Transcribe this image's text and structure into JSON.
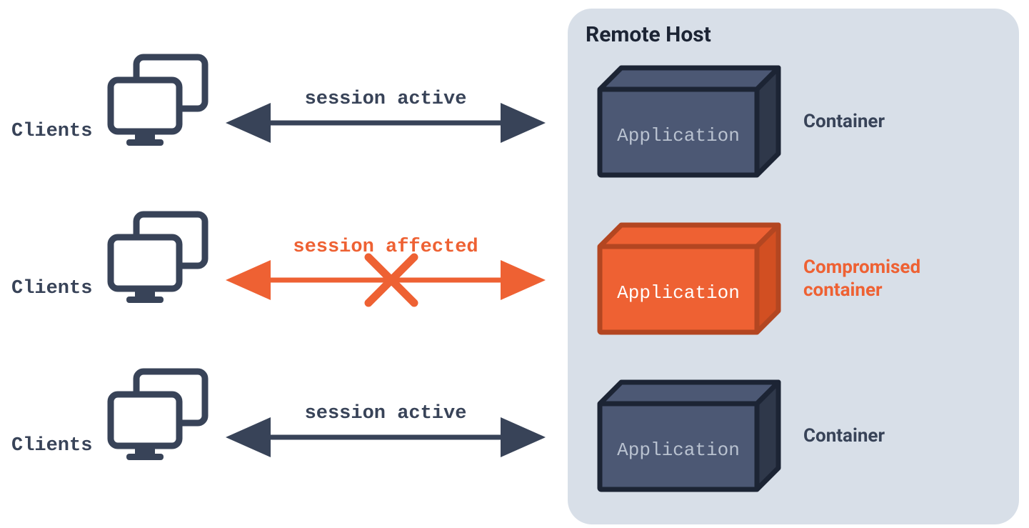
{
  "colors": {
    "dark": "#384358",
    "darkFill": "#4C5874",
    "orange": "#EE6133",
    "orangeDark": "#B34621",
    "panel": "#D8DFE8",
    "white": "#FFFFFF",
    "appText": "#B9C2D0"
  },
  "host": {
    "title": "Remote Host"
  },
  "clients": [
    {
      "label": "Clients",
      "arrow": "session active",
      "state": "normal"
    },
    {
      "label": "Clients",
      "arrow": "session affected",
      "state": "compromised"
    },
    {
      "label": "Clients",
      "arrow": "session active",
      "state": "normal"
    }
  ],
  "containers": [
    {
      "app": "Application",
      "label": "Container",
      "state": "normal"
    },
    {
      "app": "Application",
      "label": "Compromised container",
      "state": "compromised"
    },
    {
      "app": "Application",
      "label": "Container",
      "state": "normal"
    }
  ]
}
